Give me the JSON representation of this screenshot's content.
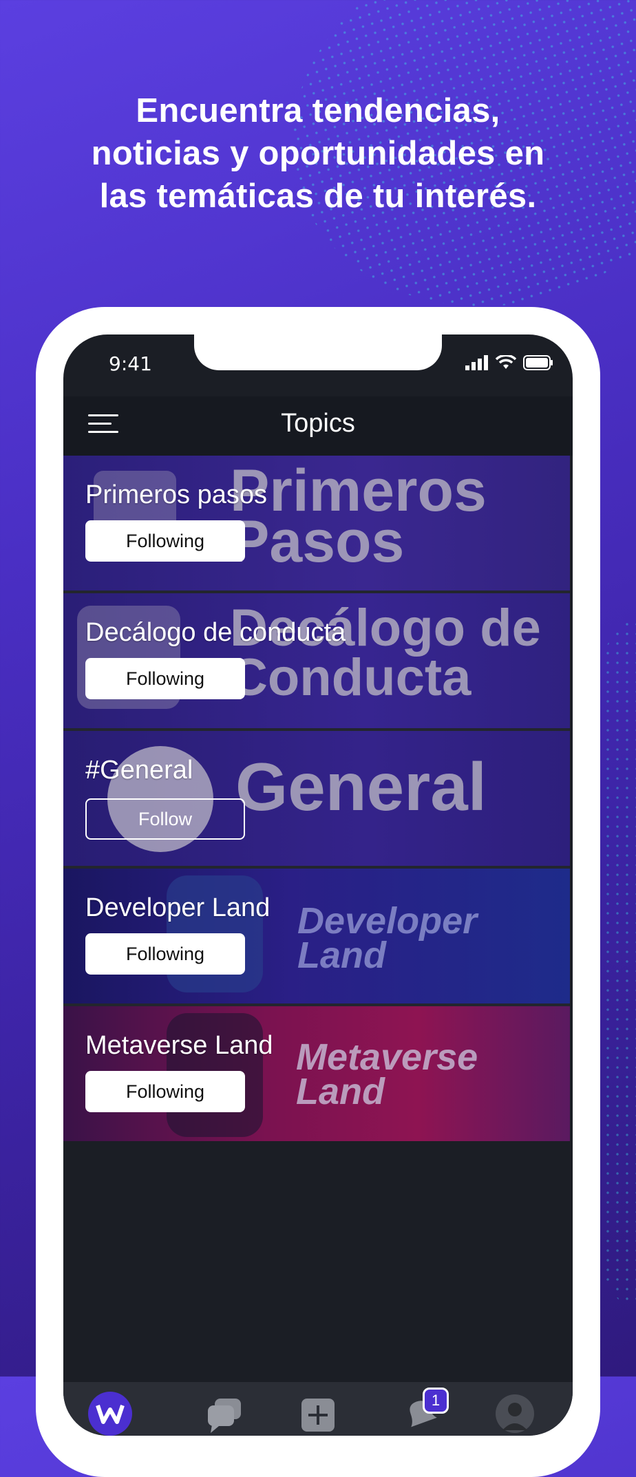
{
  "headline": {
    "line1": "Encuentra tendencias,",
    "line2": "noticias y oportunidades en",
    "line3": "las temáticas de tu interés."
  },
  "status_bar": {
    "time": "9:41",
    "icons": [
      "signal-icon",
      "wifi-icon",
      "battery-icon"
    ]
  },
  "header": {
    "title": "Topics",
    "menu_icon": "hamburger-menu-icon"
  },
  "topics": [
    {
      "name": "Primeros pasos",
      "button": "Following",
      "state": "following",
      "banner_text": [
        "Primeros",
        "Pasos"
      ]
    },
    {
      "name": "Decálogo de conducta",
      "button": "Following",
      "state": "following",
      "banner_text": [
        "Decálogo de",
        "Conducta"
      ]
    },
    {
      "name": "#General",
      "button": "Follow",
      "state": "not-following",
      "banner_text": [
        "General"
      ]
    },
    {
      "name": "Developer Land",
      "button": "Following",
      "state": "following",
      "banner_text": [
        "Developer",
        "Land"
      ]
    },
    {
      "name": "Metaverse Land",
      "button": "Following",
      "state": "following",
      "banner_text": [
        "Metaverse",
        "Land"
      ]
    }
  ],
  "tabbar": {
    "items": [
      "home-logo-icon",
      "chat-icon",
      "add-icon",
      "notifications-icon",
      "profile-avatar"
    ],
    "notification_badge": "1"
  },
  "colors": {
    "accent": "#4b2fd0",
    "background": "#5b3fe0",
    "screen": "#1b1e25",
    "dots": "#3cdce6"
  }
}
